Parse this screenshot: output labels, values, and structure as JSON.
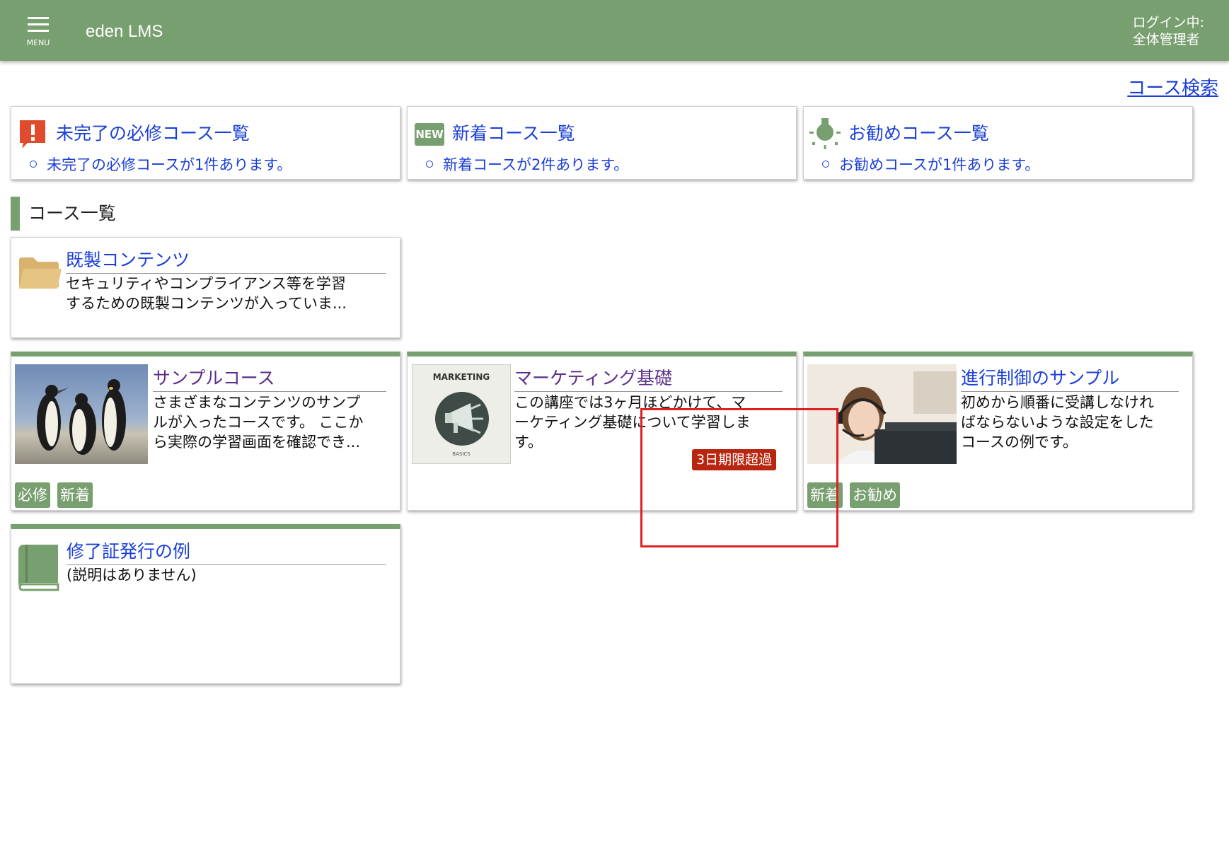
{
  "header": {
    "menu_label": "MENU",
    "app_title": "eden LMS",
    "login_line1": "ログイン中:",
    "login_line2": "全体管理者",
    "bg_color": "#789f6f"
  },
  "search_link": "コース検索",
  "summary": [
    {
      "icon": "alert-icon",
      "title": "未完了の必修コース一覧",
      "item": "未完了の必修コースが1件あります。"
    },
    {
      "icon": "new-badge-icon",
      "icon_text": "NEW",
      "title": "新着コース一覧",
      "item": "新着コースが2件あります。"
    },
    {
      "icon": "lightbulb-icon",
      "title": "お勧めコース一覧",
      "item": "お勧めコースが1件あります。"
    }
  ],
  "section_title": "コース一覧",
  "folder": {
    "icon": "folder-icon",
    "title": "既製コンテンツ",
    "desc_line1": "セキュリティやコンプライアンス等を学習",
    "desc_line2": "するための既製コンテンツが入っていま..."
  },
  "courses": [
    {
      "thumb": "penguins-image",
      "title": "サンプルコース",
      "desc_line1": "さまざまなコンテンツのサンプ",
      "desc_line2": "ルが入ったコースです。 ここか",
      "desc_line3": "ら実際の学習画面を確認でき...",
      "tags": [
        "必修",
        "新着"
      ]
    },
    {
      "thumb": "marketing-image",
      "thumb_text_top": "MARKETING",
      "thumb_text_bottom": "BASICS",
      "title": "マーケティング基礎",
      "desc_line1": "この講座では3ヶ月ほどかけて、マ",
      "desc_line2": "ーケティング基礎について学習しま",
      "desc_line3": "す。",
      "overdue": "3日期限超過"
    },
    {
      "thumb": "operator-image",
      "title": "進行制御のサンプル",
      "desc_line1": "初めから順番に受講しなけれ",
      "desc_line2": "ばならないような設定をした",
      "desc_line3": "コースの例です。",
      "tags": [
        "新着",
        "お勧め"
      ]
    },
    {
      "thumb": "book-icon",
      "title": "修了証発行の例",
      "desc_line1": "(説明はありません)"
    }
  ],
  "colors": {
    "accent": "#789f6f",
    "link": "#1a3fd8",
    "overdue": "#b8260f",
    "highlight": "#e02020"
  }
}
